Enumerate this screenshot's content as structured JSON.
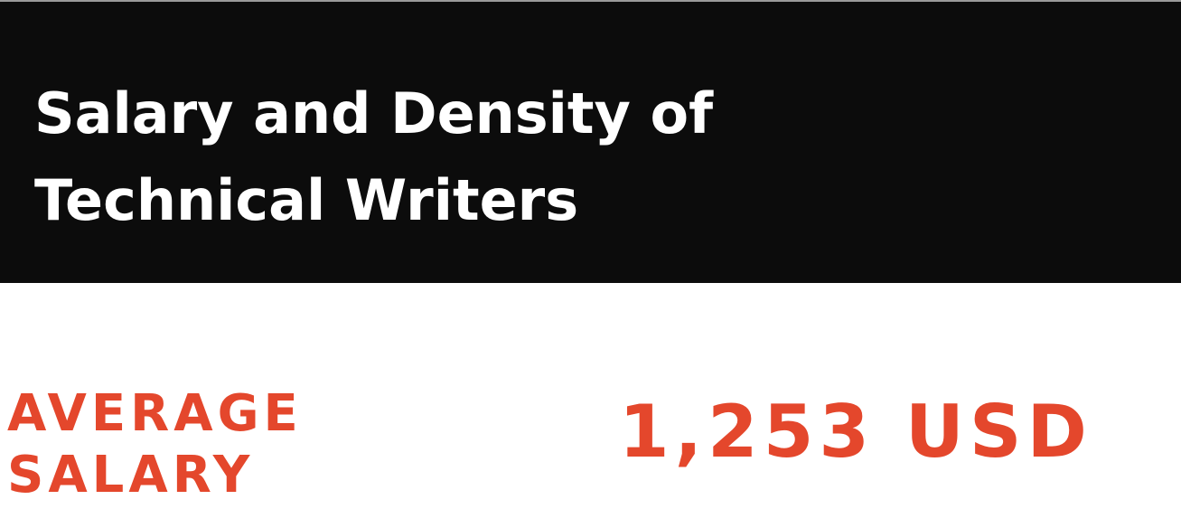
{
  "header": {
    "title_line1": "Salary and Density of",
    "title_line2": "Technical Writers",
    "background_color": "#0c0c0c",
    "text_color": "#ffffff"
  },
  "stat": {
    "label_line1": "AVERAGE",
    "label_line2": "SALARY",
    "value": "1,253 USD",
    "accent_color": "#e4472c"
  }
}
